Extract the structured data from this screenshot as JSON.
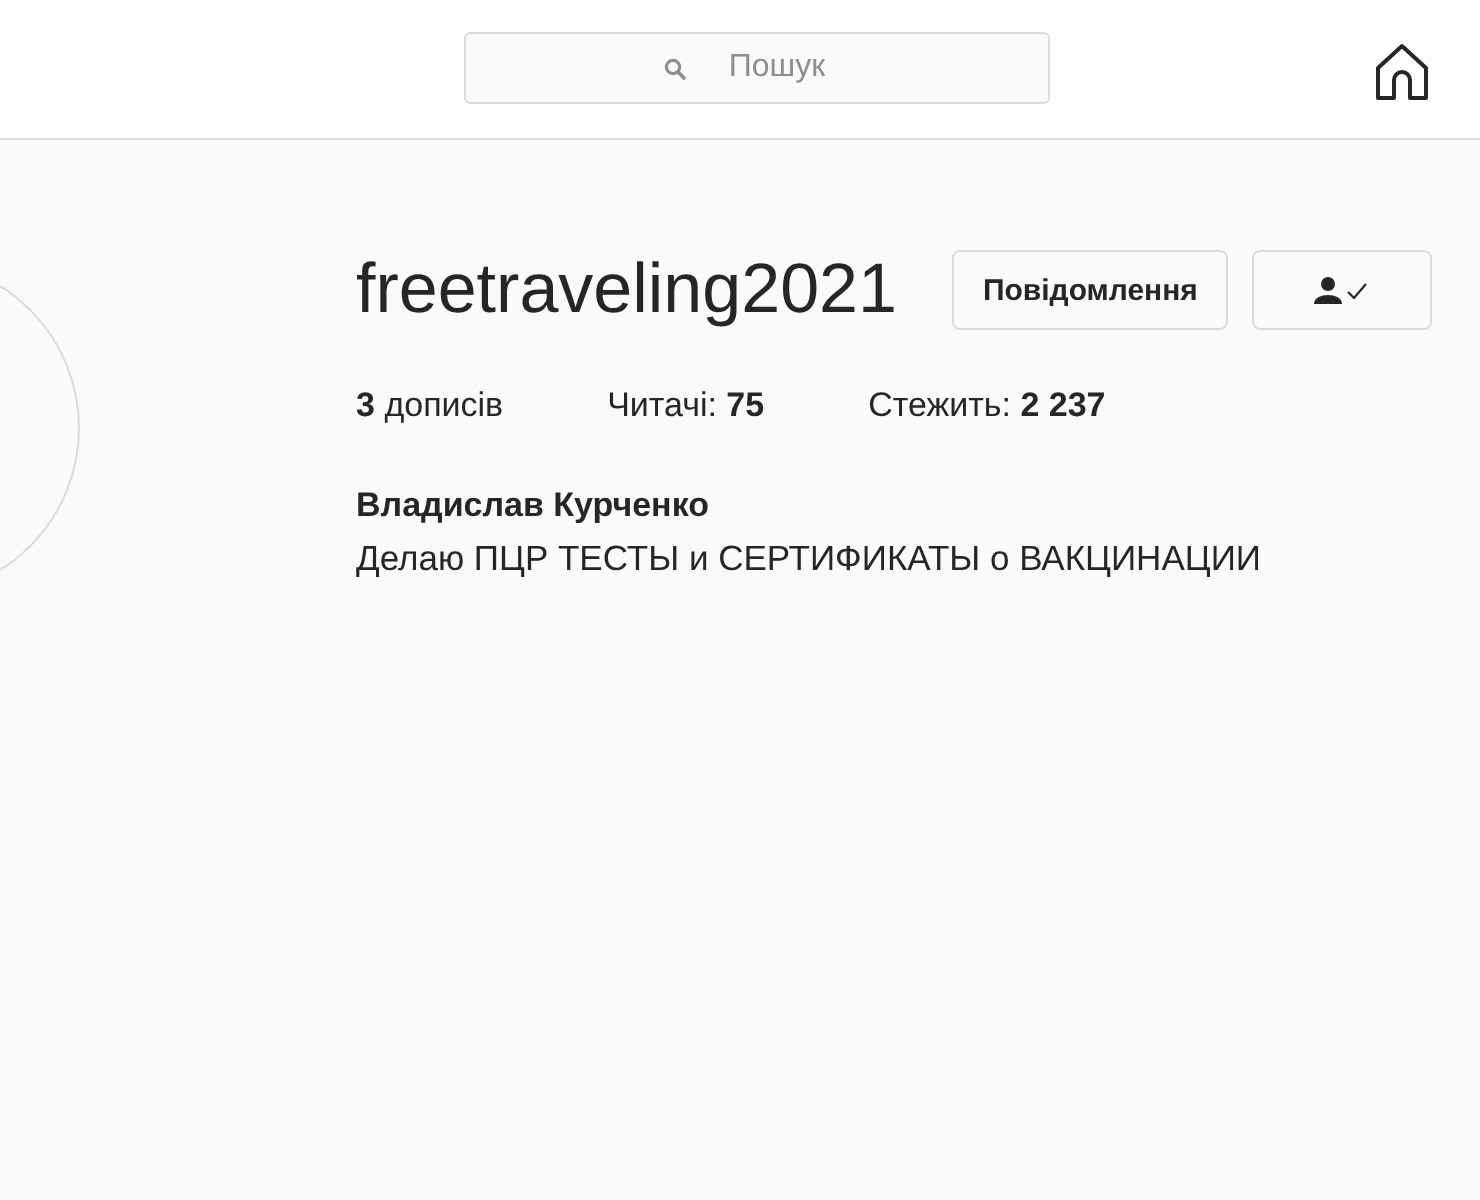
{
  "header": {
    "search": {
      "placeholder": "Пошук"
    }
  },
  "profile": {
    "username": "freetraveling2021",
    "buttons": [
      {
        "label": "Повідомлення",
        "kind": "text"
      },
      {
        "kind": "following"
      }
    ],
    "stats": [
      "**3** дописів",
      "Читачі: **75**",
      "Стежить: **2 237**"
    ],
    "full_name": "Владислав Курченко",
    "bio": "Делаю ПЦР ТЕСТЫ и СЕРТИФИКАТЫ о ВАКЦИНАЦИИ"
  }
}
